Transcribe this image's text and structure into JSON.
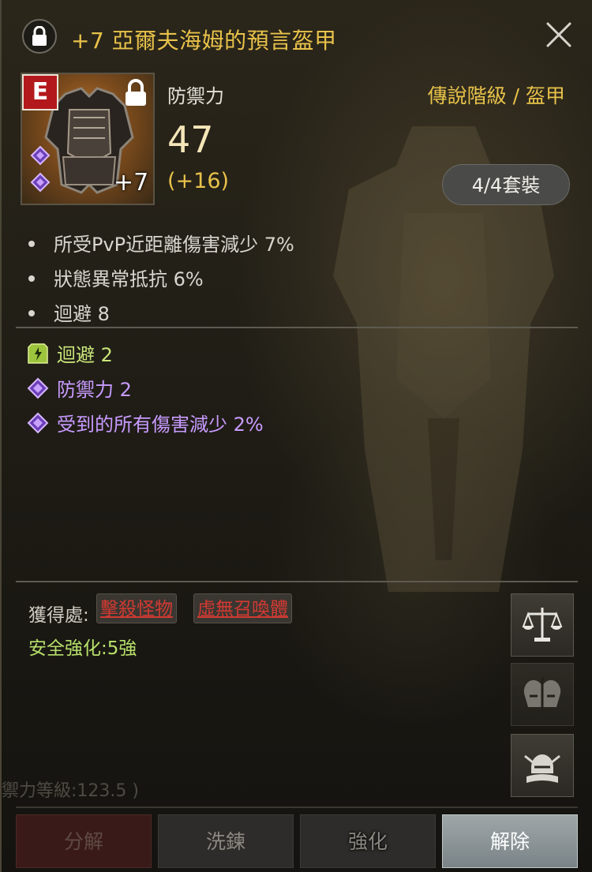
{
  "header": {
    "title": "+7 亞爾夫海姆的預言盔甲",
    "close_label": "✕"
  },
  "item": {
    "grade": "E",
    "enhance_level": "+7",
    "stat_label": "防禦力",
    "stat_value": "47",
    "stat_bonus": "(+16)",
    "category": "傳說階級 / 盔甲",
    "set_button": "4/4套裝"
  },
  "options": [
    {
      "text": "所受PvP近距離傷害減少  7%"
    },
    {
      "text": "狀態異常抵抗  6%"
    },
    {
      "text": "迴避  8"
    }
  ],
  "bonus_options": [
    {
      "text": "迴避  2",
      "icon": "green-rune-icon",
      "color": "#c9e57a"
    },
    {
      "text": "防禦力  2",
      "icon": "purple-gem-icon",
      "color": "#c89bff"
    },
    {
      "text": "受到的所有傷害減少  2%",
      "icon": "purple-gem-icon",
      "color": "#c89bff"
    }
  ],
  "source": {
    "label": "獲得處:",
    "tags": [
      "擊殺怪物",
      "虛無召喚體"
    ],
    "safe_enhance": "安全強化:5強"
  },
  "faded_text": "禦力等級:123.5 )",
  "side_buttons": [
    {
      "icon": "scales-icon"
    },
    {
      "icon": "helmet-compare-icon"
    },
    {
      "icon": "helmet-book-icon"
    }
  ],
  "actions": {
    "disassemble": "分解",
    "refine": "洗鍊",
    "enhance": "強化",
    "unequip": "解除"
  }
}
